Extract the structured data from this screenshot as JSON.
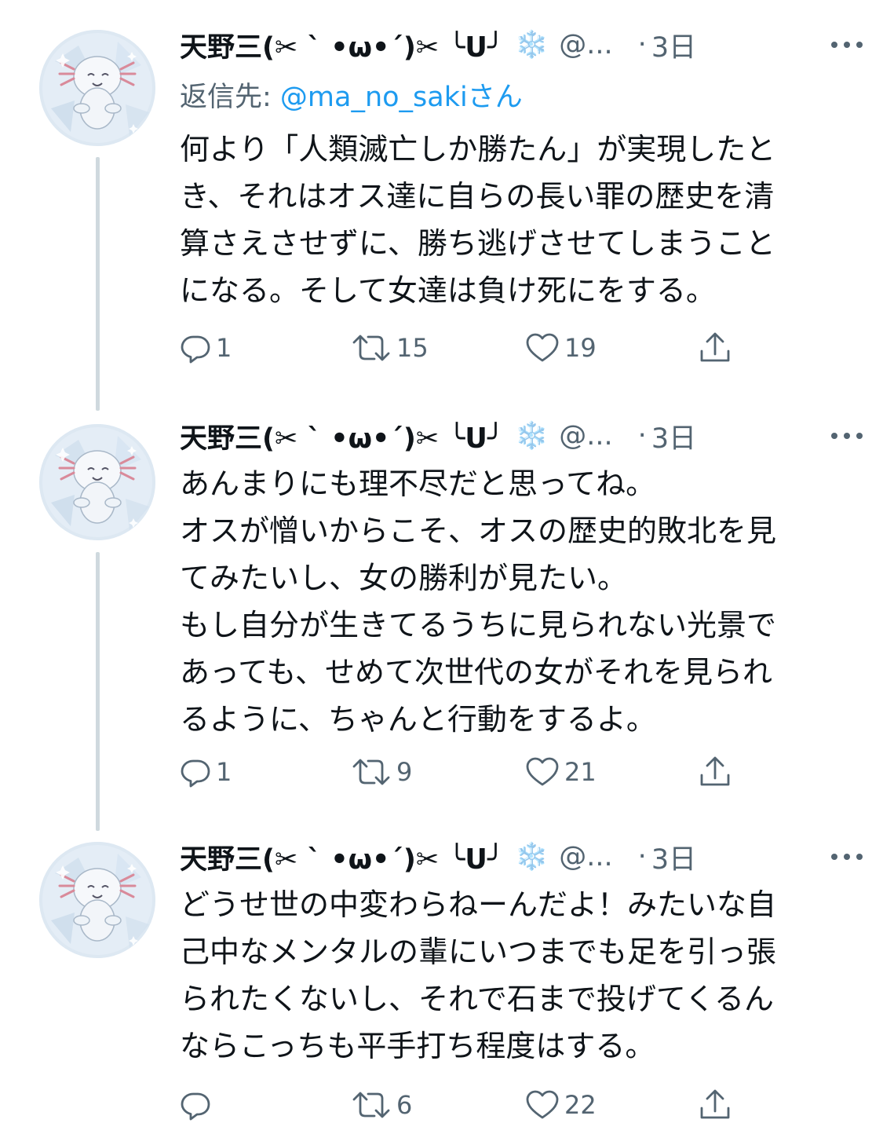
{
  "colors": {
    "accent": "#1d9bf0",
    "secondary_text": "#536471",
    "primary_text": "#0f1419",
    "thread_line": "#cfd9de"
  },
  "tweets": [
    {
      "display_name": "天野三(✂︎ ˋ •ω•´)✂︎ ╰ᑌ╯",
      "badge_icon": "snowflake-icon",
      "badge": "❄️",
      "handle": "@...",
      "separator": "·",
      "time": "3日",
      "reply_to_label": "返信先: ",
      "reply_to_mention": "@ma_no_sakiさん",
      "body_lines": [
        "何より「人類滅亡しか勝たん」が実現したと",
        "き、それはオス達に自らの長い罪の歴史を清",
        "算さえさせずに、勝ち逃げさせてしまうこと",
        "になる。そして女達は負け死にをする。"
      ],
      "reply_count": "1",
      "retweet_count": "15",
      "like_count": "19"
    },
    {
      "display_name": "天野三(✂︎ ˋ •ω•´)✂︎ ╰ᑌ╯",
      "badge_icon": "snowflake-icon",
      "badge": "❄️",
      "handle": "@...",
      "separator": "·",
      "time": "3日",
      "body_lines": [
        "あんまりにも理不尽だと思ってね。",
        "オスが憎いからこそ、オスの歴史的敗北を見",
        "てみたいし、女の勝利が見たい。",
        "もし自分が生きてるうちに見られない光景で",
        "あっても、せめて次世代の女がそれを見られ",
        "るように、ちゃんと行動をするよ。"
      ],
      "reply_count": "1",
      "retweet_count": "9",
      "like_count": "21"
    },
    {
      "display_name": "天野三(✂︎ ˋ •ω•´)✂︎ ╰ᑌ╯",
      "badge_icon": "snowflake-icon",
      "badge": "❄️",
      "handle": "@...",
      "separator": "·",
      "time": "3日",
      "body_lines": [
        "どうせ世の中変わらねーんだよ！みたいな自",
        "己中なメンタルの輩にいつまでも足を引っ張",
        "られたくないし、それで石まで投げてくるん",
        "ならこっちも平手打ち程度はする。"
      ],
      "reply_count": "",
      "retweet_count": "6",
      "like_count": "22"
    }
  ]
}
